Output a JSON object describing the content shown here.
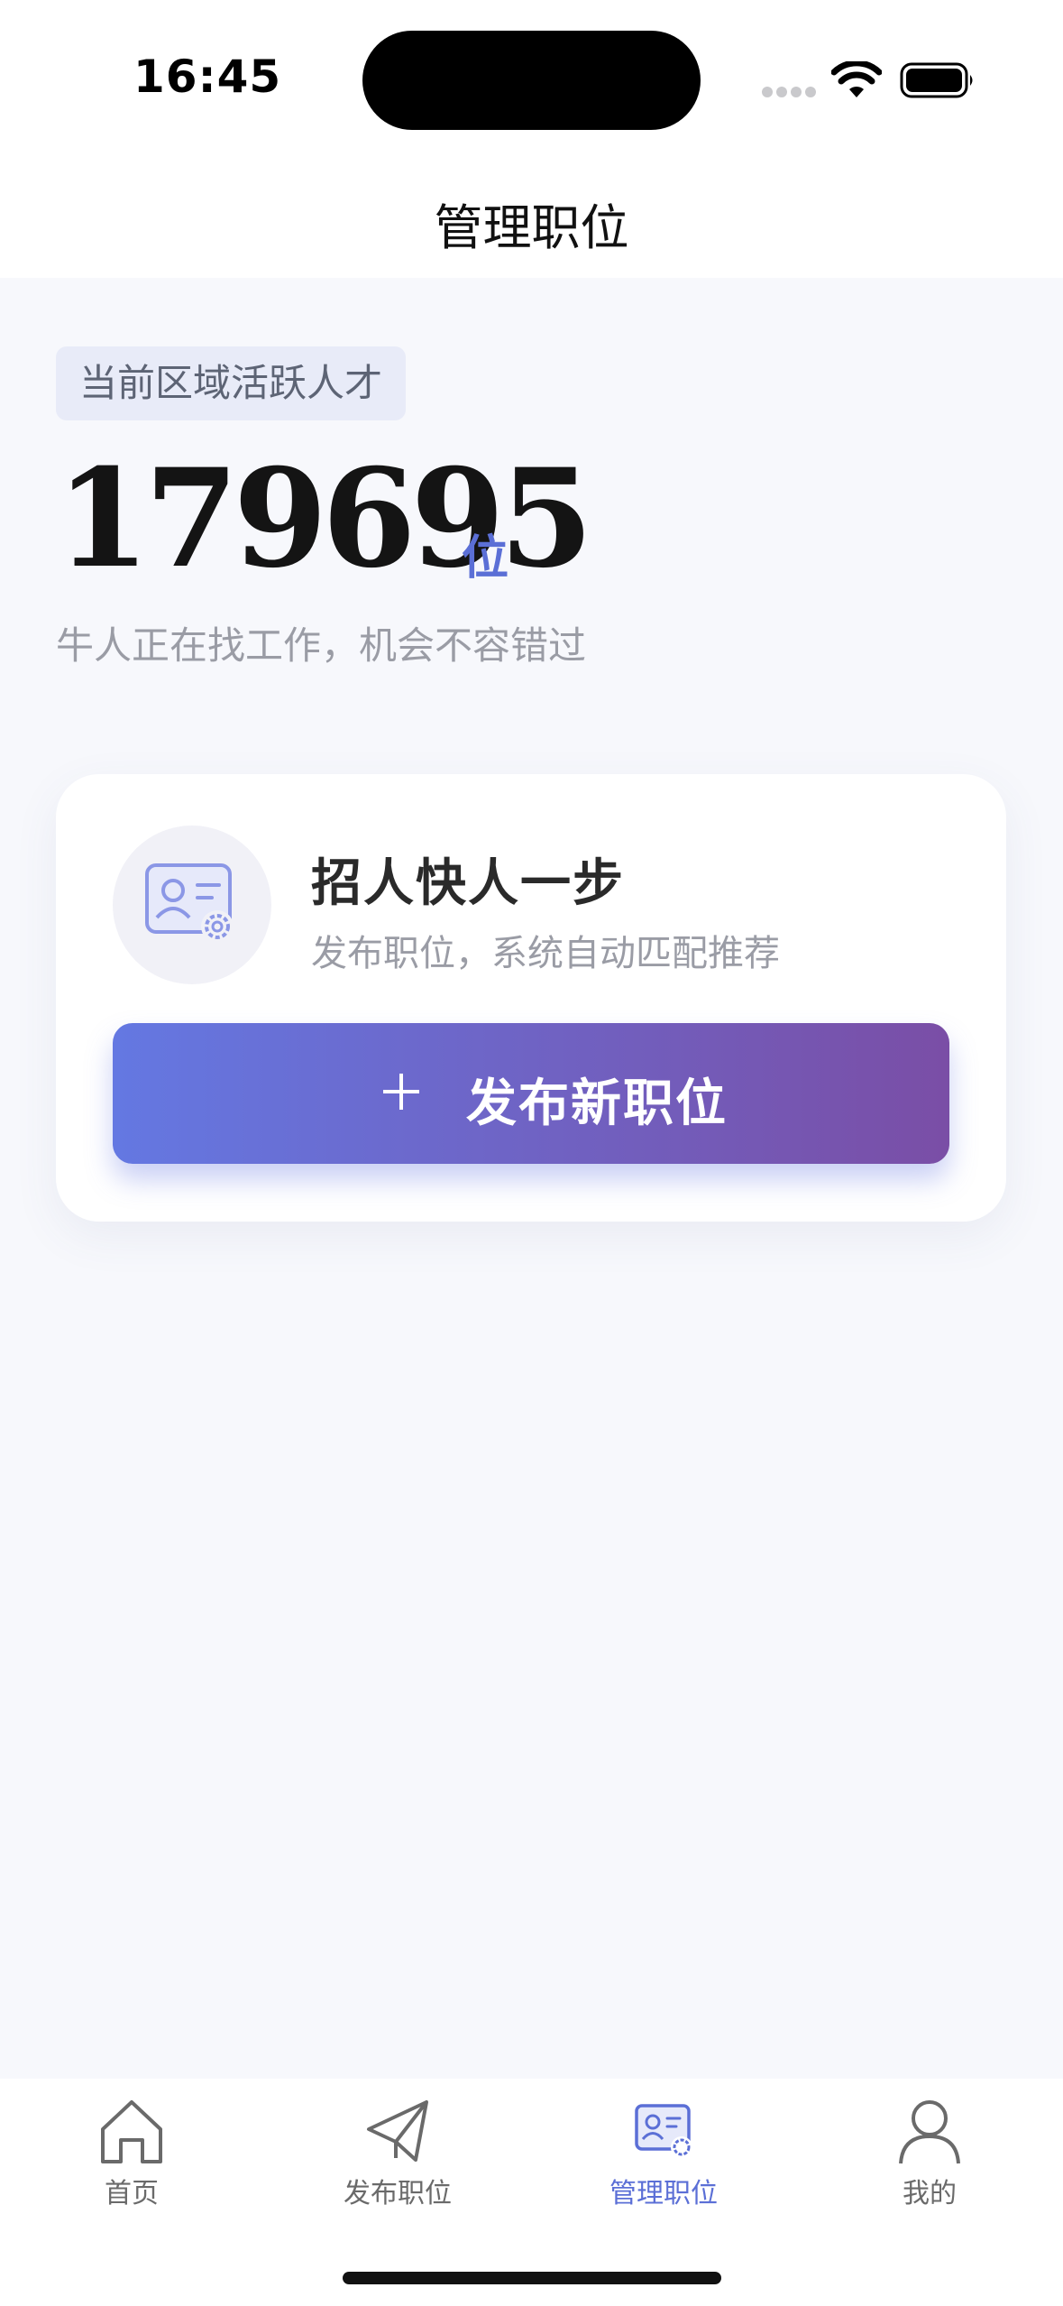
{
  "status_bar": {
    "time": "16:45",
    "icons": [
      "signal-dots-icon",
      "wifi-icon",
      "battery-icon"
    ]
  },
  "nav": {
    "title": "管理职位"
  },
  "hero": {
    "tag": "当前区域活跃人才",
    "count": "179695",
    "unit": "位",
    "subtitle": "牛人正在找工作，机会不容错过"
  },
  "card": {
    "icon": "id-card-gear-icon",
    "title": "招人快人一步",
    "subtitle": "发布职位，系统自动匹配推荐",
    "button_icon": "plus-icon",
    "button_label": "发布新职位"
  },
  "tabs": [
    {
      "label": "首页",
      "icon": "home-icon",
      "active": false
    },
    {
      "label": "发布职位",
      "icon": "paper-plane-icon",
      "active": false
    },
    {
      "label": "管理职位",
      "icon": "id-card-gear-icon",
      "active": true
    },
    {
      "label": "我的",
      "icon": "user-icon",
      "active": false
    }
  ],
  "colors": {
    "accent": "#5B6FD6",
    "button_gradient_start": "#6478E2",
    "button_gradient_end": "#7A4EA6",
    "background": "#F7F8FC"
  }
}
